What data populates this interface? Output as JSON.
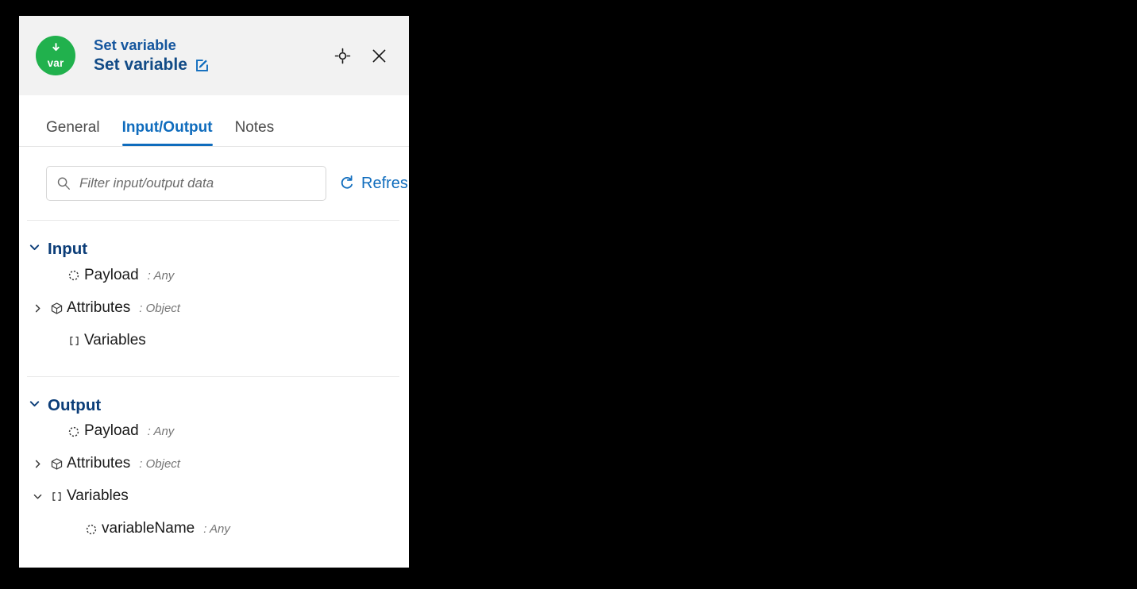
{
  "panel": {
    "badge": {
      "label": "var",
      "icon": "down-arrow-icon",
      "color": "#21b14d"
    },
    "title_kind": "Set variable",
    "title_name": "Set variable",
    "edit_icon": "edit-pencil-square-icon",
    "actions": [
      {
        "name": "locate-node-button",
        "icon": "crosshair-target-icon"
      },
      {
        "name": "close-panel-button",
        "icon": "close-x-icon"
      }
    ]
  },
  "tabs": [
    {
      "label": "General",
      "active": false
    },
    {
      "label": "Input/Output",
      "active": true
    },
    {
      "label": "Notes",
      "active": false
    }
  ],
  "toolbar": {
    "search_placeholder": "Filter input/output data",
    "search_value": "",
    "search_icon": "search-magnifier-icon",
    "refresh_label": "Refresh",
    "refresh_icon": "refresh-circular-arrow-icon"
  },
  "sections": [
    {
      "title": "Input",
      "expanded": true,
      "rows": [
        {
          "label": "Payload",
          "type": ": Any",
          "icon": "dashed-circle-icon",
          "twisty": "none",
          "level": 1
        },
        {
          "label": "Attributes",
          "type": ": Object",
          "icon": "cube-icon",
          "twisty": "collapsed",
          "level": 1
        },
        {
          "label": "Variables",
          "type": "",
          "icon": "brackets-icon",
          "twisty": "none",
          "level": 1
        }
      ]
    },
    {
      "title": "Output",
      "expanded": true,
      "rows": [
        {
          "label": "Payload",
          "type": ": Any",
          "icon": "dashed-circle-icon",
          "twisty": "none",
          "level": 1
        },
        {
          "label": "Attributes",
          "type": ": Object",
          "icon": "cube-icon",
          "twisty": "collapsed",
          "level": 1
        },
        {
          "label": "Variables",
          "type": "",
          "icon": "brackets-icon",
          "twisty": "expanded",
          "level": 1
        },
        {
          "label": "variableName",
          "type": ": Any",
          "icon": "dashed-circle-icon",
          "twisty": "none",
          "level": 2
        }
      ]
    }
  ],
  "colors": {
    "accent_blue": "#0f6cbd",
    "title_navy": "#124b86",
    "section_navy": "#0b3d78",
    "badge_green": "#21b14d",
    "header_bg": "#f2f2f2"
  }
}
